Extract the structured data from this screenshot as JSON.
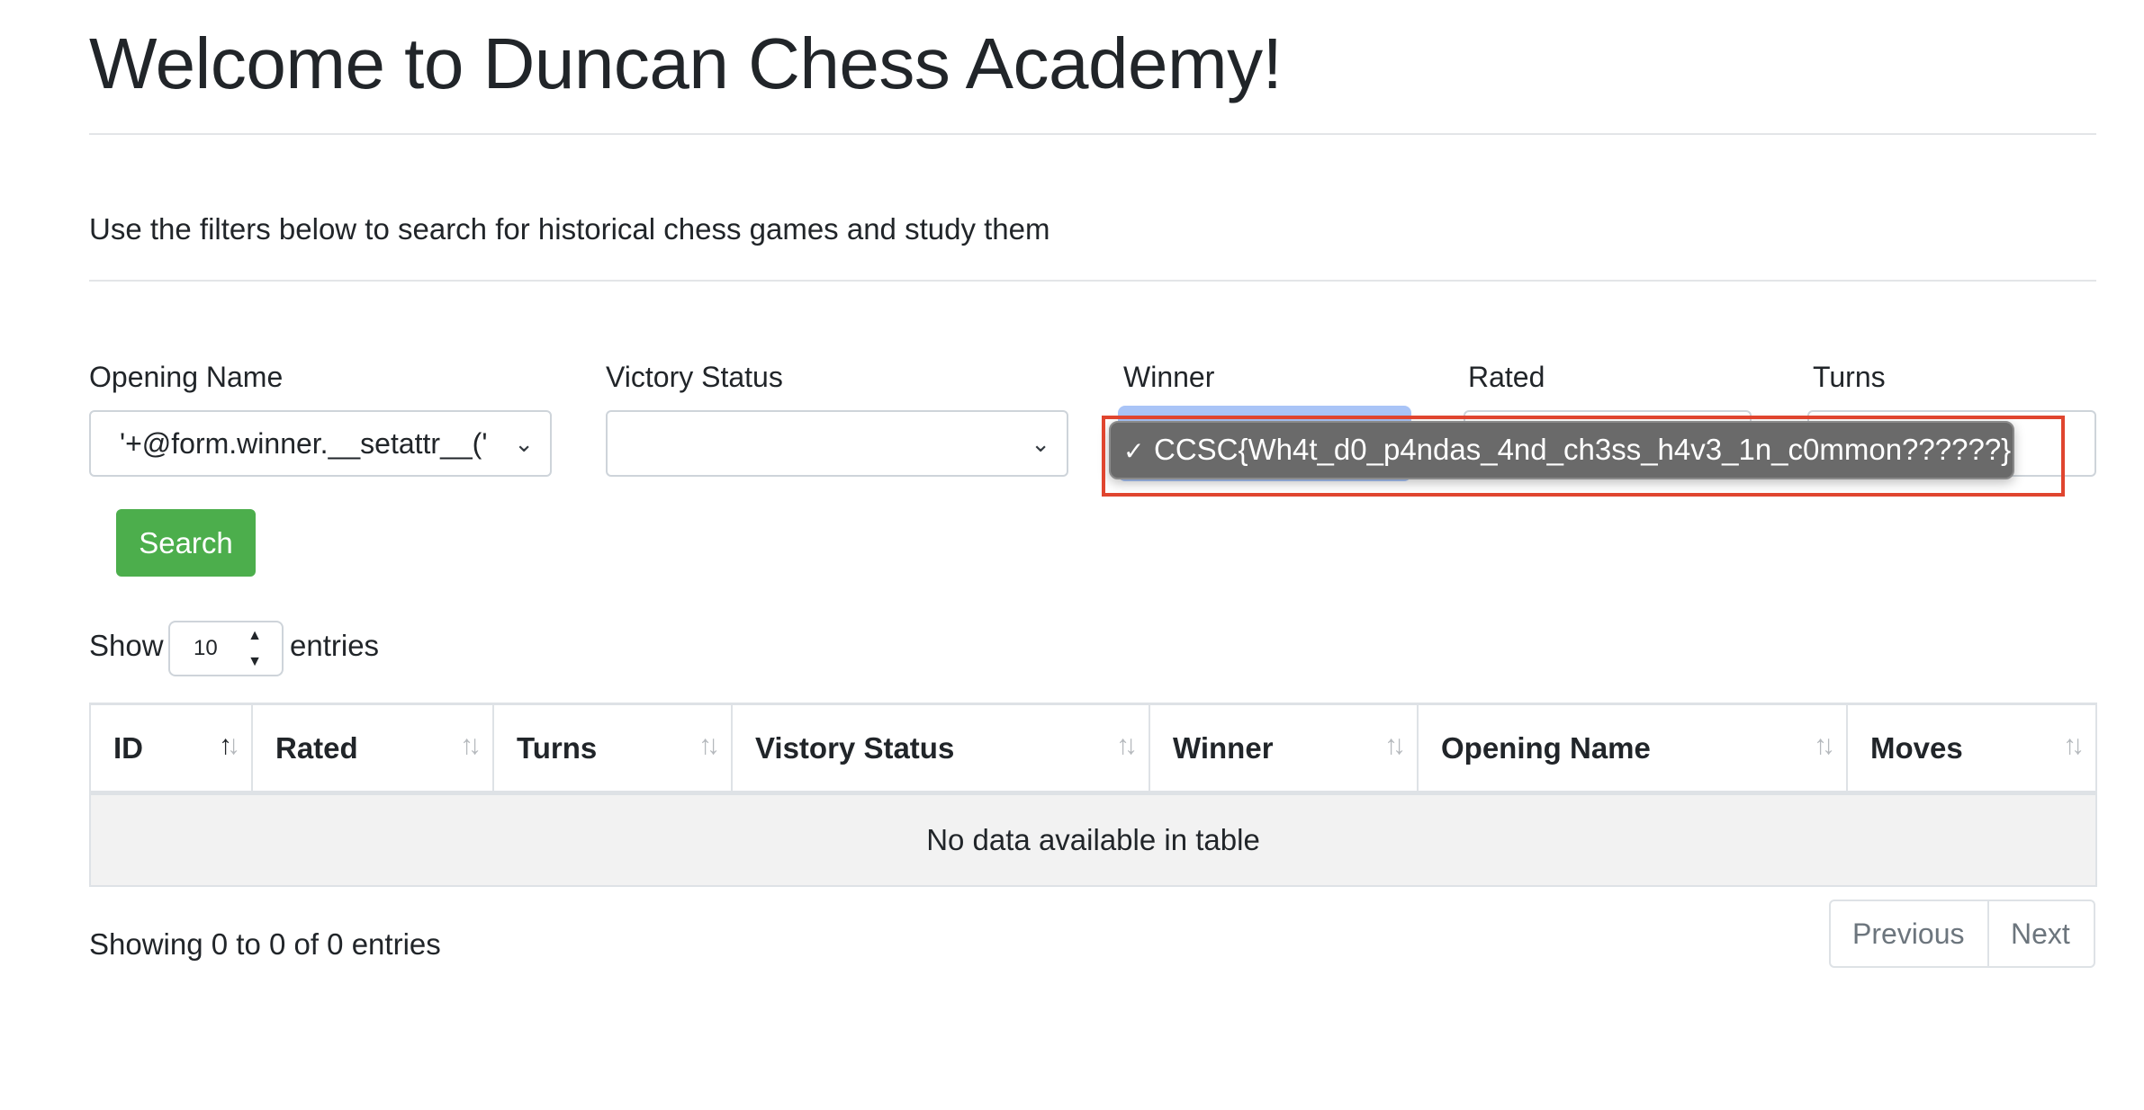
{
  "page": {
    "title": "Welcome to Duncan Chess Academy!",
    "intro": "Use the filters below to search for historical chess games and study them"
  },
  "filters": {
    "opening_name": {
      "label": "Opening Name",
      "value": "'+@form.winner.__setattr__('"
    },
    "victory_status": {
      "label": "Victory Status",
      "value": ""
    },
    "winner": {
      "label": "Winner",
      "dropdown_option": "CCSC{Wh4t_d0_p4ndas_4nd_ch3ss_h4v3_1n_c0mmon??????}"
    },
    "rated": {
      "label": "Rated"
    },
    "turns": {
      "label": "Turns"
    },
    "search_button": "Search"
  },
  "length_menu": {
    "show_label": "Show",
    "value": "10",
    "entries_label": "entries"
  },
  "table": {
    "columns": [
      "ID",
      "Rated",
      "Turns",
      "Vistory Status",
      "Winner",
      "Opening Name",
      "Moves"
    ],
    "empty_message": "No data available in table"
  },
  "footer": {
    "info": "Showing 0 to 0 of 0 entries",
    "previous": "Previous",
    "next": "Next"
  },
  "colors": {
    "search_button": "#4cae4c",
    "highlight_box": "#e0452f",
    "dropdown_bg": "#6a6a6a",
    "winner_select_focus": "#a9c4f7"
  }
}
